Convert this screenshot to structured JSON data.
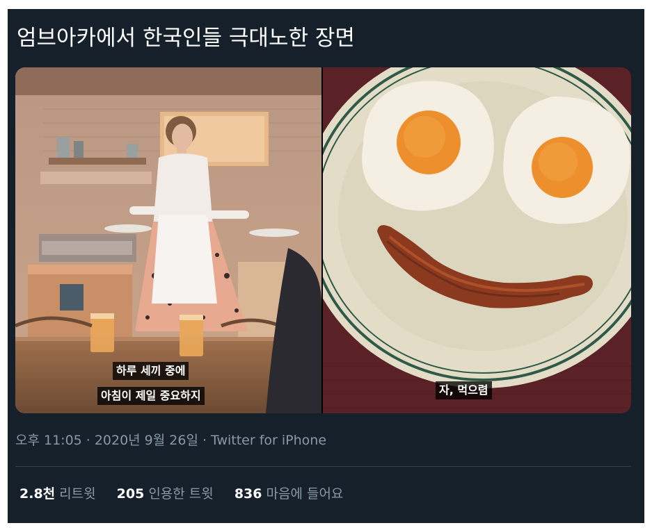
{
  "tweet": {
    "text": "엄브아카에서 한국인들 극대노한 장면",
    "media": {
      "left_subtitle_line1": "하루 세끼 중에",
      "left_subtitle_line2": "아침이 제일 중요하지",
      "right_subtitle": "자, 먹으렴"
    },
    "meta": {
      "time": "오후 11:05",
      "separator": "·",
      "date": "2020년 9월 26일",
      "source": "Twitter for iPhone"
    },
    "stats": {
      "retweets_count": "2.8천",
      "retweets_label": "리트윗",
      "quotes_count": "205",
      "quotes_label": "인용한 트윗",
      "likes_count": "836",
      "likes_label": "마음에 들어요"
    }
  },
  "colors": {
    "background": "#15202b",
    "primary_text": "#ffffff",
    "secondary_text": "#8899a6",
    "divider": "#38444d"
  }
}
